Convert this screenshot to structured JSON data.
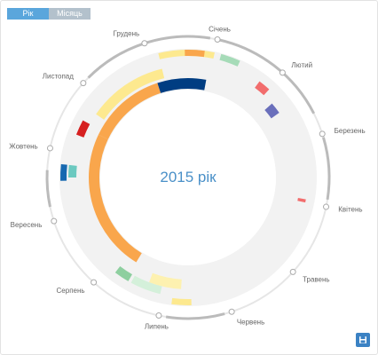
{
  "toggle": {
    "year_label": "Рік",
    "month_label": "Місяць",
    "active_color": "#5aa6dc",
    "inactive_color": "#b3c1cc"
  },
  "center": {
    "title": "2015 рік"
  },
  "months": [
    "Січень",
    "Лютий",
    "Березень",
    "Квітень",
    "Травень",
    "Червень",
    "Липень",
    "Серпень",
    "Вересень",
    "Жовтень",
    "Листопад",
    "Грудень"
  ],
  "colors": {
    "outer_ring": "#bbbbbb",
    "marker_fill": "#ffffff",
    "marker_stroke": "#aaaaaa",
    "track": "#f2f2f2",
    "title": "#4a90c8",
    "save_button": "#3b82c4"
  },
  "save_button": {
    "icon": "floppy-disk-icon"
  },
  "outer_arcs": [
    {
      "start_month": 0,
      "end_month": 1.7
    },
    {
      "start_month": 2.05,
      "end_month": 2.9
    },
    {
      "start_month": 5.1,
      "end_month": 5.9
    },
    {
      "start_month": 8.2,
      "end_month": 8.7
    },
    {
      "start_month": 10.1,
      "end_month": 11.9
    }
  ],
  "chart_data": {
    "type": "radial-timeline",
    "period": "2015",
    "bands": [
      {
        "track": 0,
        "start_month": 11.15,
        "end_month": 0.0,
        "color": "#fde98f"
      },
      {
        "track": 0,
        "start_month": 11.55,
        "end_month": 11.85,
        "color": "#f9a64c"
      },
      {
        "track": 0,
        "start_month": 0.1,
        "end_month": 0.4,
        "color": "#a6dbb8"
      },
      {
        "track": 1,
        "start_month": 0.82,
        "end_month": 1.02,
        "color": "#f26d6d"
      },
      {
        "track": 2,
        "start_month": 1.22,
        "end_month": 1.42,
        "color": "#6a6fbb"
      },
      {
        "track": 1,
        "start_month": 2.95,
        "end_month": 3.0,
        "color": "#f26d6d"
      },
      {
        "track": 2,
        "start_month": 5.72,
        "end_month": 6.28,
        "color": "#fdf1b0"
      },
      {
        "track": 1,
        "start_month": 6.05,
        "end_month": 6.55,
        "color": "#d4f0da"
      },
      {
        "track": 1,
        "start_month": 6.6,
        "end_month": 6.85,
        "color": "#8ecf9f"
      },
      {
        "track": 0,
        "start_month": 5.55,
        "end_month": 5.85,
        "color": "#fde98f"
      },
      {
        "track": 1,
        "start_month": 8.6,
        "end_month": 8.8,
        "color": "#6cc9c0"
      },
      {
        "track": 0,
        "start_month": 8.55,
        "end_month": 8.8,
        "color": "#1668b0"
      },
      {
        "track": 1,
        "start_month": 9.3,
        "end_month": 9.55,
        "color": "#d62020"
      },
      {
        "track": 3,
        "start_month": 6.65,
        "end_month": 9.45,
        "color": "#f9a64c"
      },
      {
        "track": 3,
        "start_month": 9.45,
        "end_month": 11.0,
        "color": "#f9a64c"
      },
      {
        "track": 2,
        "start_month": 9.75,
        "end_month": 11.15,
        "color": "#fde98f"
      },
      {
        "track": 3,
        "start_month": 11.0,
        "end_month": 11.95,
        "color": "#003d82"
      }
    ]
  }
}
